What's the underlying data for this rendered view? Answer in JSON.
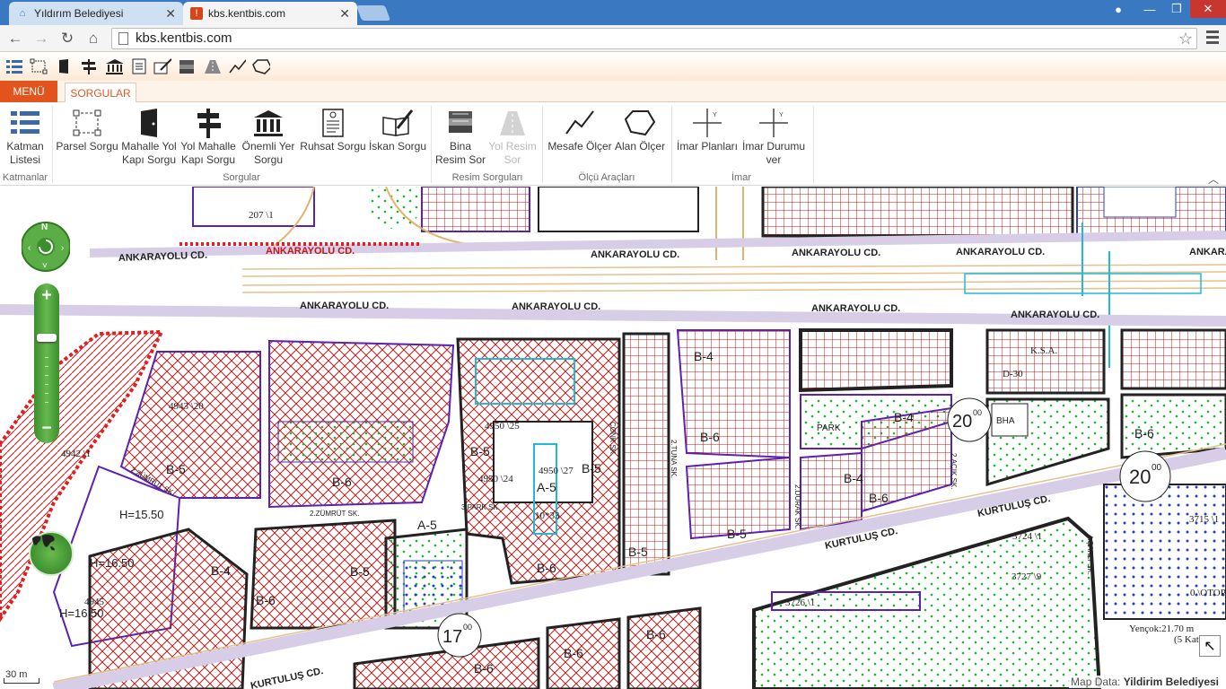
{
  "browser": {
    "tabs": [
      {
        "title": "Yıldırım Belediyesi",
        "active": false
      },
      {
        "title": "kbs.kentbis.com",
        "active": true
      }
    ],
    "url": "kbs.kentbis.com"
  },
  "app": {
    "menu_label": "MENÜ",
    "tab_label": "SORGULAR",
    "quick_icons": [
      "layers-icon",
      "parcel-icon",
      "door-icon",
      "signpost-icon",
      "building-icon",
      "permit-icon",
      "occupancy-icon",
      "photo-stack-icon",
      "photo-road-icon",
      "measure-line-icon",
      "measure-area-icon"
    ],
    "ribbon": {
      "katmanlar": {
        "group": "Katmanlar",
        "items": [
          {
            "label": "Katman Listesi"
          }
        ]
      },
      "sorgular": {
        "group": "Sorgular",
        "items": [
          {
            "label": "Parsel Sorgu"
          },
          {
            "label": "Mahalle Yol Kapı Sorgu"
          },
          {
            "label": "Yol Mahalle Kapı Sorgu"
          },
          {
            "label": "Önemli Yer Sorgu"
          },
          {
            "label": "Ruhsat Sorgu"
          },
          {
            "label": "İskan Sorgu"
          }
        ]
      },
      "resim": {
        "group": "Resim Sorguları",
        "items": [
          {
            "label": "Bina Resim Sor"
          },
          {
            "label": "Yol Resim Sor",
            "disabled": true
          }
        ]
      },
      "olcu": {
        "group": "Ölçü Araçları",
        "items": [
          {
            "label": "Mesafe Ölçer"
          },
          {
            "label": "Alan Ölçer"
          }
        ]
      },
      "imar": {
        "group": "İmar",
        "items": [
          {
            "label": "İmar Planları"
          },
          {
            "label": "İmar Durumu ver"
          }
        ]
      }
    }
  },
  "map": {
    "compass_label": "N",
    "street_labels": {
      "ankarayolu_1": "ANKARAYOLU CD.",
      "ankarayolu_2": "ANKARAYOLU CD.",
      "ankarayolu_3": "ANKARAYOLU CD.",
      "ankarayolu_4": "ANKARAYOLU CD.",
      "ankarayolu_5": "ANKARAYOLU CD.",
      "ankarayolu_6": "ANKARAYOLU CD.",
      "ankarayolu_7": "ANKARAYOLU CD.",
      "ankarayolu_8": "ANKARAYOLU CD.",
      "ankarayolu_9": "ANKARAYOLU CD.",
      "kurtulus_1": "KURTULUŞ CD.",
      "kurtulus_2": "KURTULUŞ CD.",
      "kurtulus_3": "KURTULUŞ CD.",
      "zumrut_1": "2.ZÜMRÜT SK.",
      "zumrut_2": "2.ZÜMRÜT SK.",
      "park": "3.PARK SK.",
      "conk": "ÇONK SK.",
      "tuna": "2.TUNA SK.",
      "durak": "2.DURAK SK.",
      "acik": "2.AÇIK SK.",
      "sanli": "4.ŞANLI SK."
    },
    "zone_labels": [
      "B-5",
      "A-5",
      "B-6",
      "B-4",
      "A-5",
      "B-5",
      "B-6",
      "B-4",
      "B-6",
      "B-5",
      "B-6",
      "B-4",
      "B-6",
      "B-5",
      "B-5",
      "B-5",
      "B-4",
      "B-6",
      "B-6",
      "B-6",
      "B-6"
    ],
    "parcel_labels": {
      "p207": "207 \\1",
      "p4943": "4943 \\20",
      "p4942": "4942 \\1",
      "p4950a": "4950 \\25",
      "p4950b": "4950 \\24",
      "p4950c": "4950 \\27",
      "p3715": "3715 \\1",
      "p3724": "3724 \\1",
      "p3727": "3727 \\9",
      "p3726": "3726 \\1",
      "p4945": "4945",
      "h1": "H=15.50",
      "h2": "H=16.50",
      "h3": "H=16.50",
      "park": "PARK",
      "bha": "BHA",
      "otop": "0 \\OTOP",
      "yencok": "Yençok:21.70 m",
      "kat": "(5 Kat)",
      "dim": "10*33",
      "ksa": "K.S.A.",
      "d30": "D-30"
    },
    "heights": [
      "20",
      "20",
      "17"
    ],
    "heights_sup": [
      "00",
      "00",
      "00"
    ],
    "scale": "30 m"
  },
  "attribution": {
    "prefix": "Map Data: ",
    "name": "Yildirim Belediyesi"
  }
}
